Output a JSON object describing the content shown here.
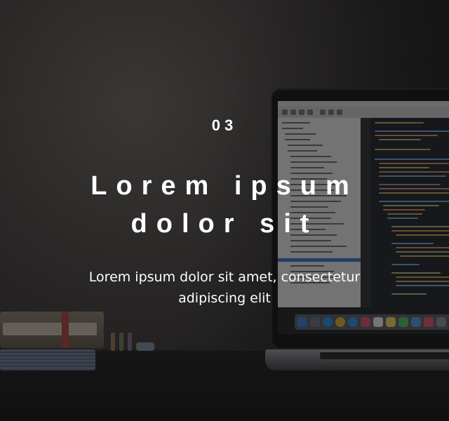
{
  "slide": {
    "number": "03",
    "title_line1": "Lorem ipsum",
    "title_line2": "dolor sit",
    "subtitle_line1": "Lorem ipsum dolor sit amet, consectetur",
    "subtitle_line2": "adipiscing elit"
  },
  "background": {
    "overlay_color": "#121214",
    "text_color": "#ffffff"
  }
}
